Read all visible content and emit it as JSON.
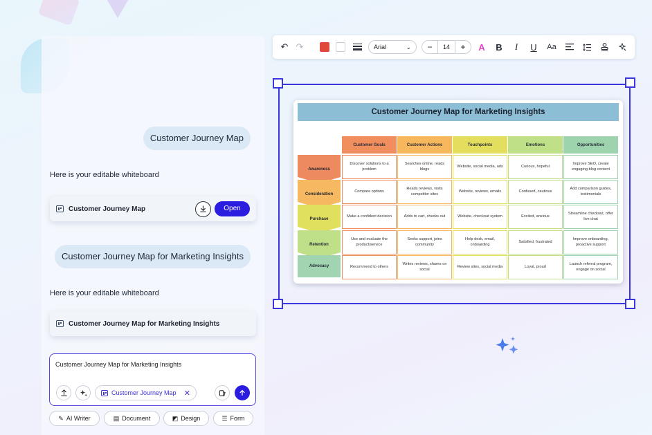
{
  "chat": {
    "user_msg_1": "Customer Journey Map",
    "bot_msg_1": "Here is your editable whiteboard",
    "card_1_title": "Customer Journey Map",
    "open_label": "Open",
    "user_msg_2": "Customer Journey Map for Marketing Insights",
    "bot_msg_2": "Here is your editable whiteboard",
    "card_2_title": "Customer Journey Map for Marketing Insights",
    "input_text": "Customer Journey Map for Marketing Insights",
    "attachment_chip": "Customer Journey Map",
    "tools": [
      "AI Writer",
      "Document",
      "Design",
      "Form"
    ]
  },
  "toolbar": {
    "font": "Arial",
    "font_size": "14",
    "fill_color": "#e0473d",
    "stroke_color": "#ffffff",
    "icons": [
      "undo-icon",
      "redo-icon",
      "fill-color",
      "stroke-color",
      "line-weight-icon",
      "font-select",
      "font-size",
      "text-color-icon",
      "bold-icon",
      "italic-icon",
      "underline-icon",
      "text-case-icon",
      "align-icon",
      "line-spacing-icon",
      "stamp-icon",
      "magic-icon"
    ]
  },
  "board": {
    "title": "Customer Journey Map for Marketing Insights",
    "columns": [
      {
        "label": "Customer Goals",
        "color": "#f08e5d"
      },
      {
        "label": "Customer Actions",
        "color": "#f7b75c"
      },
      {
        "label": "Touchpoints",
        "color": "#e3de5e"
      },
      {
        "label": "Emotions",
        "color": "#bfe086"
      },
      {
        "label": "Opportunities",
        "color": "#9ed4ad"
      }
    ],
    "stages": [
      {
        "label": "Awareness",
        "color": "#ee8a5f"
      },
      {
        "label": "Consideration",
        "color": "#f6b861"
      },
      {
        "label": "Purchase",
        "color": "#e0e05e"
      },
      {
        "label": "Retention",
        "color": "#bfe089"
      },
      {
        "label": "Advocacy",
        "color": "#a1d5b1"
      }
    ],
    "rows": [
      [
        "Discover solutions to a problem",
        "Searches online, reads blogs",
        "Website, social media, ads",
        "Curious, hopeful",
        "Improve SEO, create engaging blog content"
      ],
      [
        "Compare options",
        "Reads reviews, visits competitor sites",
        "Website, reviews, emails",
        "Confused, cautious",
        "Add comparison guides, testimonials"
      ],
      [
        "Make a confident decision",
        "Adds to cart, checks out",
        "Website, checkout system",
        "Excited, anxious",
        "Streamline checkout, offer live chat"
      ],
      [
        "Use and evaluate the product/service",
        "Seeks support, joins community",
        "Help desk, email, onboarding",
        "Satisfied, frustrated",
        "Improve onboarding, proactive support"
      ],
      [
        "Recommend to others",
        "Writes reviews, shares on social",
        "Review sites, social media",
        "Loyal, proud",
        "Launch referral program, engage on social"
      ]
    ]
  }
}
